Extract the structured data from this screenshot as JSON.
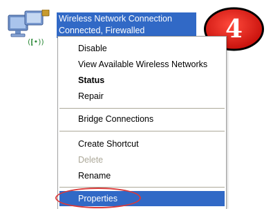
{
  "connection": {
    "name": "Wireless Network Connection",
    "status": "Connected, Firewalled",
    "icon": "network-computer-icon"
  },
  "step_badge": {
    "number": "4",
    "color": "#e32119",
    "icon": "step-number-badge"
  },
  "context_menu": {
    "items": [
      {
        "label": "Disable",
        "style": "normal"
      },
      {
        "label": "View Available Wireless Networks",
        "style": "normal"
      },
      {
        "label": "Status",
        "style": "bold"
      },
      {
        "label": "Repair",
        "style": "normal"
      },
      {
        "label": "Bridge Connections",
        "style": "normal"
      },
      {
        "label": "Create Shortcut",
        "style": "normal"
      },
      {
        "label": "Delete",
        "style": "disabled"
      },
      {
        "label": "Rename",
        "style": "normal"
      },
      {
        "label": "Properties",
        "style": "selected"
      }
    ]
  },
  "colors": {
    "selection": "#3169c6",
    "highlight_ring": "#d93a3a",
    "disabled_text": "#aca899"
  }
}
